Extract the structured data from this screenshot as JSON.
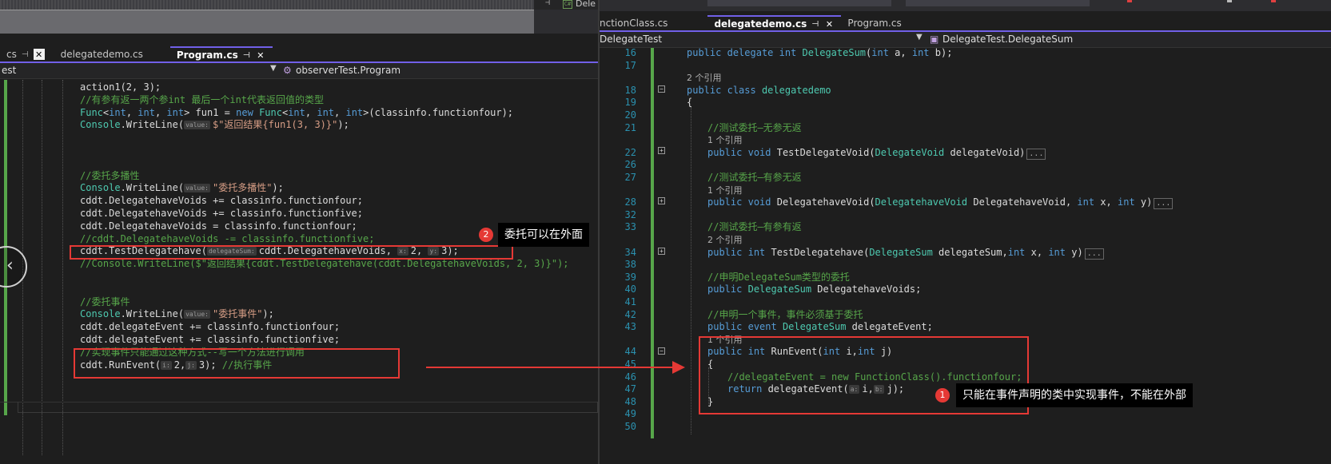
{
  "left": {
    "mini_tab": "Dele",
    "tabs": [
      {
        "label": "cs",
        "pinned": true,
        "closable": true
      },
      {
        "label": "delegatedemo.cs"
      },
      {
        "label": "Program.cs",
        "active": true
      }
    ],
    "nav": {
      "project": "est",
      "member": "observerTest.Program"
    },
    "lines": [
      {
        "segs": [
          [
            "",
            "action1(2, 3);"
          ]
        ]
      },
      {
        "segs": [
          [
            "cmt",
            "//有参有返一两个参int 最后一个int代表返回值的类型"
          ]
        ]
      },
      {
        "segs": [
          [
            "ty",
            "Func"
          ],
          [
            "",
            "<"
          ],
          [
            "kw",
            "int"
          ],
          [
            "",
            ", "
          ],
          [
            "kw",
            "int"
          ],
          [
            "",
            ", "
          ],
          [
            "kw",
            "int"
          ],
          [
            "",
            "> fun1 = "
          ],
          [
            "kw",
            "new"
          ],
          [
            "",
            " "
          ],
          [
            "ty",
            "Func"
          ],
          [
            "",
            "<"
          ],
          [
            "kw",
            "int"
          ],
          [
            "",
            ", "
          ],
          [
            "kw",
            "int"
          ],
          [
            "",
            ", "
          ],
          [
            "kw",
            "int"
          ],
          [
            "",
            ">(classinfo.functionfour);"
          ]
        ]
      },
      {
        "segs": [
          [
            "ty",
            "Console"
          ],
          [
            "",
            ".WriteLine("
          ],
          [
            "hint",
            "value:"
          ],
          [
            "str",
            "$\"返回结果{fun1(3, 3)}\""
          ],
          [
            "",
            ");"
          ]
        ]
      },
      {
        "segs": []
      },
      {
        "segs": []
      },
      {
        "segs": []
      },
      {
        "segs": [
          [
            "cmt",
            "//委托多播性"
          ]
        ]
      },
      {
        "segs": [
          [
            "ty",
            "Console"
          ],
          [
            "",
            ".WriteLine("
          ],
          [
            "hint",
            "value:"
          ],
          [
            "str",
            "\"委托多播性\""
          ],
          [
            "",
            ");"
          ]
        ]
      },
      {
        "segs": [
          [
            "",
            "cddt.DelegatehaveVoids += classinfo.functionfour;"
          ]
        ]
      },
      {
        "segs": [
          [
            "",
            "cddt.DelegatehaveVoids += classinfo.functionfive;"
          ]
        ]
      },
      {
        "segs": [
          [
            "",
            "cddt.DelegatehaveVoids = classinfo.functionfour;"
          ]
        ]
      },
      {
        "segs": [
          [
            "cmt",
            "//cddt.DelegatehaveVoids -= classinfo.functionfive;"
          ]
        ]
      },
      {
        "segs": [
          [
            "",
            "cddt.TestDelegatehave("
          ],
          [
            "hint",
            "delegateSum:"
          ],
          [
            "",
            "cddt.DelegatehaveVoids, "
          ],
          [
            "hint",
            "x:"
          ],
          [
            "",
            "2, "
          ],
          [
            "hint",
            "y:"
          ],
          [
            "",
            "3);"
          ]
        ]
      },
      {
        "segs": [
          [
            "cmt",
            "//Console.WriteLine($\"返回结果{cddt.TestDelegatehave(cddt.DelegatehaveVoids, 2, 3)}\");"
          ]
        ]
      },
      {
        "segs": []
      },
      {
        "segs": []
      },
      {
        "segs": [
          [
            "cmt",
            "//委托事件"
          ]
        ]
      },
      {
        "segs": [
          [
            "ty",
            "Console"
          ],
          [
            "",
            ".WriteLine("
          ],
          [
            "hint",
            "value:"
          ],
          [
            "str",
            "\"委托事件\""
          ],
          [
            "",
            ");"
          ]
        ]
      },
      {
        "segs": [
          [
            "",
            "cddt.delegateEvent += classinfo.functionfour;"
          ]
        ]
      },
      {
        "segs": [
          [
            "",
            "cddt.delegateEvent += classinfo.functionfive;"
          ]
        ]
      },
      {
        "segs": [
          [
            "cmt",
            "//实现事件只能通过这种方式--写一个方法进行调用"
          ]
        ]
      },
      {
        "segs": [
          [
            "",
            "cddt.RunEvent("
          ],
          [
            "hint",
            "i:"
          ],
          [
            "",
            "2,"
          ],
          [
            "hint",
            "j:"
          ],
          [
            "",
            "3); "
          ],
          [
            "cmt",
            "//执行事件"
          ]
        ]
      }
    ]
  },
  "right": {
    "tabs": [
      {
        "label": "nctionClass.cs"
      },
      {
        "label": "delegatedemo.cs",
        "active": true
      },
      {
        "label": "Program.cs"
      }
    ],
    "nav": {
      "class": "DelegateTest",
      "member": "DelegateTest.DelegateSum"
    },
    "lines": [
      {
        "n": "16",
        "segs": [
          [
            "kw",
            "public"
          ],
          [
            "",
            " "
          ],
          [
            "kw",
            "delegate"
          ],
          [
            "",
            " "
          ],
          [
            "kw",
            "int"
          ],
          [
            "",
            " "
          ],
          [
            "ty",
            "DelegateSum"
          ],
          [
            "",
            "("
          ],
          [
            "kw",
            "int"
          ],
          [
            "",
            " a, "
          ],
          [
            "kw",
            "int"
          ],
          [
            "",
            " b);"
          ]
        ]
      },
      {
        "n": "17",
        "segs": []
      },
      {
        "n": "",
        "segs": [
          [
            "ref",
            "2 个引用"
          ]
        ]
      },
      {
        "n": "18",
        "segs": [
          [
            "kw",
            "public"
          ],
          [
            "",
            " "
          ],
          [
            "kw",
            "class"
          ],
          [
            "",
            " "
          ],
          [
            "ty",
            "delegatedemo"
          ]
        ]
      },
      {
        "n": "19",
        "segs": [
          [
            "",
            "{"
          ]
        ]
      },
      {
        "n": "20",
        "segs": []
      },
      {
        "n": "21",
        "segs": [
          [
            "cmt",
            "//测试委托—无参无返"
          ]
        ]
      },
      {
        "n": "",
        "segs": [
          [
            "ref",
            "1 个引用"
          ]
        ]
      },
      {
        "n": "22",
        "segs": [
          [
            "kw",
            "public"
          ],
          [
            "",
            " "
          ],
          [
            "kw",
            "void"
          ],
          [
            "",
            " TestDelegateVoid("
          ],
          [
            "ty",
            "DelegateVoid"
          ],
          [
            "",
            " delegateVoid)"
          ],
          [
            "ellip",
            "..."
          ]
        ]
      },
      {
        "n": "26",
        "segs": []
      },
      {
        "n": "27",
        "segs": [
          [
            "cmt",
            "//测试委托—有参无返"
          ]
        ]
      },
      {
        "n": "",
        "segs": [
          [
            "ref",
            "1 个引用"
          ]
        ]
      },
      {
        "n": "28",
        "segs": [
          [
            "kw",
            "public"
          ],
          [
            "",
            " "
          ],
          [
            "kw",
            "void"
          ],
          [
            "",
            " DelegatehaveVoid("
          ],
          [
            "ty",
            "DelegatehaveVoid"
          ],
          [
            "",
            " DelegatehaveVoid, "
          ],
          [
            "kw",
            "int"
          ],
          [
            "",
            " x, "
          ],
          [
            "kw",
            "int"
          ],
          [
            "",
            " y)"
          ],
          [
            "ellip",
            "..."
          ]
        ]
      },
      {
        "n": "32",
        "segs": []
      },
      {
        "n": "33",
        "segs": [
          [
            "cmt",
            "//测试委托—有参有返"
          ]
        ]
      },
      {
        "n": "",
        "segs": [
          [
            "ref",
            "2 个引用"
          ]
        ]
      },
      {
        "n": "34",
        "segs": [
          [
            "kw",
            "public"
          ],
          [
            "",
            " "
          ],
          [
            "kw",
            "int"
          ],
          [
            "",
            " TestDelegatehave("
          ],
          [
            "ty",
            "DelegateSum"
          ],
          [
            "",
            " delegateSum,"
          ],
          [
            "kw",
            "int"
          ],
          [
            "",
            " x, "
          ],
          [
            "kw",
            "int"
          ],
          [
            "",
            " y)"
          ],
          [
            "ellip",
            "..."
          ]
        ]
      },
      {
        "n": "38",
        "segs": []
      },
      {
        "n": "39",
        "segs": [
          [
            "cmt",
            "//申明DelegateSum类型的委托"
          ]
        ]
      },
      {
        "n": "40",
        "segs": [
          [
            "kw",
            "public"
          ],
          [
            "",
            " "
          ],
          [
            "ty",
            "DelegateSum"
          ],
          [
            "",
            " DelegatehaveVoids;"
          ]
        ]
      },
      {
        "n": "41",
        "segs": []
      },
      {
        "n": "42",
        "segs": [
          [
            "cmt",
            "//申明一个事件，事件必须基于委托"
          ]
        ]
      },
      {
        "n": "43",
        "segs": [
          [
            "kw",
            "public"
          ],
          [
            "",
            " "
          ],
          [
            "kw",
            "event"
          ],
          [
            "",
            " "
          ],
          [
            "ty",
            "DelegateSum"
          ],
          [
            "",
            " delegateEvent;"
          ]
        ]
      },
      {
        "n": "",
        "segs": [
          [
            "ref",
            "1 个引用"
          ]
        ]
      },
      {
        "n": "44",
        "segs": [
          [
            "kw",
            "public"
          ],
          [
            "",
            " "
          ],
          [
            "kw",
            "int"
          ],
          [
            "",
            " RunEvent("
          ],
          [
            "kw",
            "int"
          ],
          [
            "",
            " i,"
          ],
          [
            "kw",
            "int"
          ],
          [
            "",
            " j)"
          ]
        ]
      },
      {
        "n": "45",
        "segs": [
          [
            "",
            "{"
          ]
        ]
      },
      {
        "n": "46",
        "segs": [
          [
            "cmt",
            "//delegateEvent = new FunctionClass().functionfour;"
          ]
        ]
      },
      {
        "n": "47",
        "segs": [
          [
            "kw",
            "return"
          ],
          [
            "",
            " delegateEvent("
          ],
          [
            "hint",
            "a:"
          ],
          [
            "",
            "i,"
          ],
          [
            "hint",
            "b:"
          ],
          [
            "",
            "j);"
          ]
        ]
      },
      {
        "n": "48",
        "segs": [
          [
            "",
            "}"
          ]
        ]
      },
      {
        "n": "49",
        "segs": []
      },
      {
        "n": "50",
        "segs": []
      }
    ]
  },
  "annotations": {
    "badge1": "1",
    "callout1": "只能在事件声明的类中实现事件，不能在外部",
    "badge2": "2",
    "callout2": "委托可以在外面"
  },
  "colors": {
    "annotation_red": "#e53935",
    "keyword": "#569cd6",
    "type": "#4ec9b0",
    "comment": "#57a64a",
    "string": "#d69d85"
  }
}
